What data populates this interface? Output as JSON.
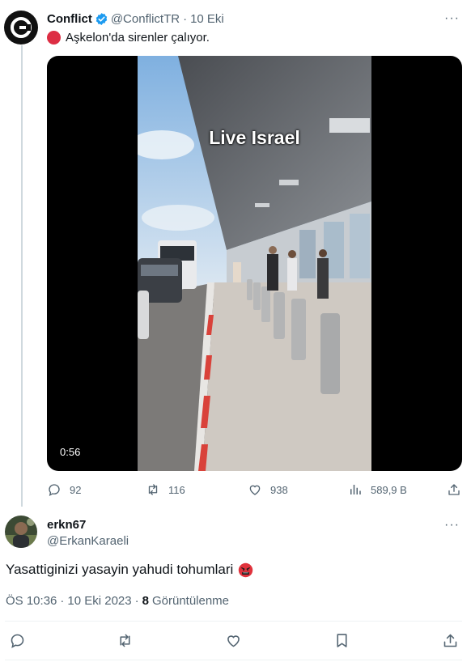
{
  "parent": {
    "name": "Conflict",
    "handle": "@ConflictTR",
    "dot": "·",
    "date": "10 Eki",
    "more": "···",
    "text": "Aşkelon'da sirenler çalıyor.",
    "video": {
      "overlay_text": "Live Israel",
      "duration": "0:56"
    },
    "actions": {
      "replies": "92",
      "reposts": "116",
      "likes": "938",
      "views": "589,9 B"
    }
  },
  "reply": {
    "name": "erkn67",
    "handle": "@ErkanKaraeli",
    "more": "···",
    "text": "Yasattiginizi yasayin yahudi tohumlari",
    "time": "ÖS 10:36",
    "sep": "·",
    "date": "10 Eki 2023",
    "sep2": "·",
    "view_count": "8",
    "views_label": "Görüntülenme"
  },
  "colors": {
    "text_primary": "#0f1419",
    "text_secondary": "#536471",
    "verified_blue": "#1d9bf0",
    "thread_line": "#cfd9de",
    "divider": "#eff3f4"
  }
}
